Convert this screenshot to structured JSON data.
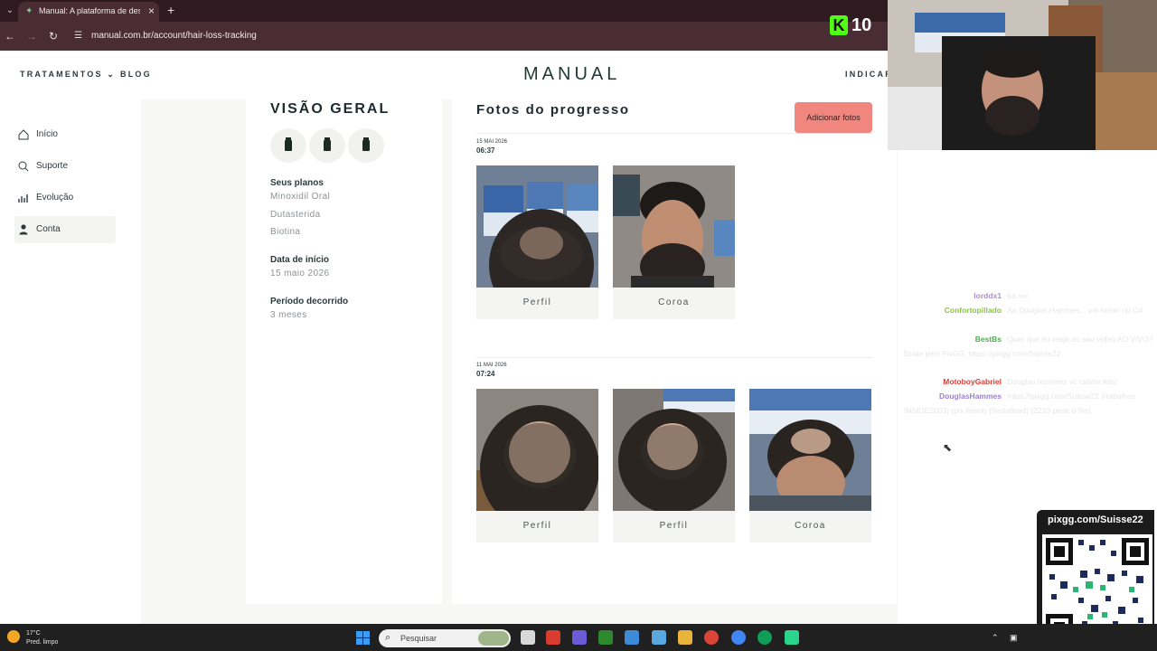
{
  "browser": {
    "tab_title": "Manual: A plataforma de destino",
    "url": "manual.com.br/account/hair-loss-tracking",
    "new_tab_symbol": "+",
    "close_symbol": "×"
  },
  "stream": {
    "k_logo": "K",
    "viewer_count": "10",
    "qr_url": "pixgg.com/Suisse22"
  },
  "site": {
    "logo": "MANUAL",
    "nav": {
      "tratamentos": "TRATAMENTOS",
      "blog": "BLOG",
      "indicar": "INDICAR"
    }
  },
  "sidebar": {
    "items": [
      {
        "label": "Início",
        "icon": "home-icon",
        "active": false
      },
      {
        "label": "Suporte",
        "icon": "search-icon",
        "active": false
      },
      {
        "label": "Evolução",
        "icon": "bar-chart-icon",
        "active": false
      },
      {
        "label": "Conta",
        "icon": "person-icon",
        "active": true
      }
    ]
  },
  "overview": {
    "title": "VISÃO GERAL",
    "plans_label": "Seus planos",
    "plans": [
      "Minoxidil Oral",
      "Dutasterida",
      "Biotina"
    ],
    "start_label": "Data de início",
    "start_value": "15 maio 2026",
    "elapsed_label": "Período decorrido",
    "elapsed_value": "3 meses"
  },
  "progress": {
    "title": "Fotos do progresso",
    "add_button": "Adicionar fotos",
    "groups": [
      {
        "date": "15 MAI 2026",
        "time": "06:37",
        "photos": [
          {
            "caption": "Perfil"
          },
          {
            "caption": "Coroa"
          }
        ]
      },
      {
        "date": "11 MAI 2026",
        "time": "07:24",
        "photos": [
          {
            "caption": "Perfil"
          },
          {
            "caption": "Perfil"
          },
          {
            "caption": "Coroa"
          }
        ]
      }
    ]
  },
  "chat": [
    {
      "user": "lorddx1",
      "msg": "ba sei",
      "color": "#b08fd0"
    },
    {
      "user": "Confortopillado",
      "msg": "Ae Douglas Hammes... vai tomar no C#",
      "color": "#8bc34a"
    },
    {
      "user": "BestBs",
      "msg": "Quer que eu reaja ao seu vídeo AO VIVO? Envie pelo PixGG: https://pixgg.com/Suisse22",
      "color": "#4caf50"
    },
    {
      "user": "MotoboyGabriel",
      "msg": "Douglas hammes vc calvite feio!",
      "color": "#e53935"
    },
    {
      "user": "DouglasHammes",
      "msg": "https://pixgg.com/Suisse22 (trabalhos INSIDE2003) (pix fiesta) (fiestafixed) (2210 pede o file)",
      "color": "#9c7fd6"
    }
  ],
  "taskbar": {
    "temp": "17°C",
    "condition": "Pred. limpo",
    "search_placeholder": "Pesquisar"
  }
}
